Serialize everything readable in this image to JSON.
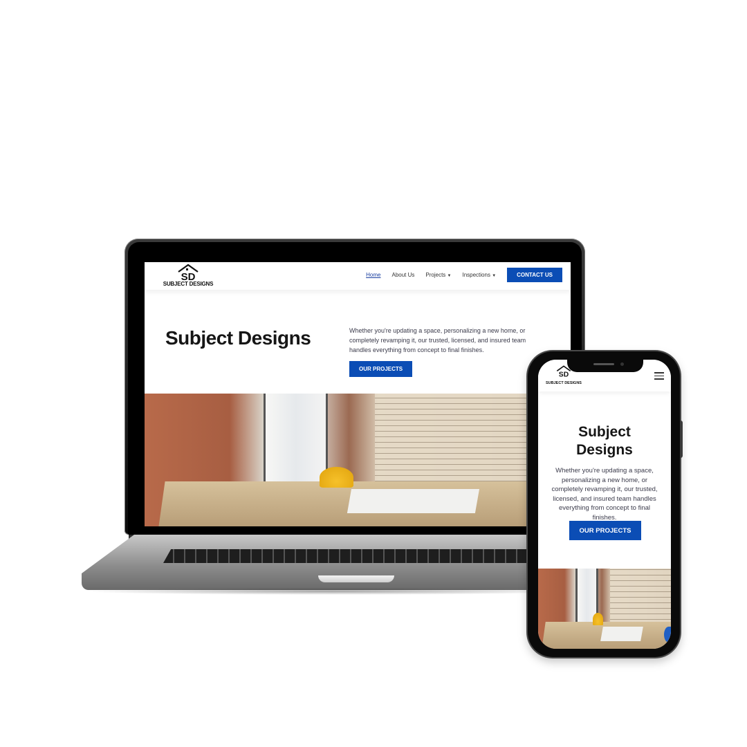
{
  "site": {
    "logo_text": "SUBJECT DESIGNS",
    "nav": {
      "items": [
        {
          "label": "Home",
          "active": true
        },
        {
          "label": "About Us"
        },
        {
          "label": "Projects",
          "dropdown": true
        },
        {
          "label": "Inspections",
          "dropdown": true
        }
      ],
      "contact_label": "CONTACT US"
    },
    "hero": {
      "title": "Subject Designs",
      "text": "Whether you're updating a space, personalizing a new home, or completely revamping it, our trusted, licensed, and insured team handles everything from concept to final finishes.",
      "button_label": "OUR PROJECTS"
    },
    "image_icon": "construction-site-photo",
    "colors": {
      "accent": "#0b4db5",
      "text": "#161616"
    }
  },
  "mobile": {
    "logo_text": "SUBJECT DESIGNS",
    "title_line1": "Subject",
    "title_line2": "Designs",
    "text": "Whether you're updating a space, personalizing a new home, or completely revamping it, our trusted, licensed, and insured team handles everything from concept to final finishes.",
    "button_label": "OUR PROJECTS",
    "menu_icon": "hamburger-icon"
  }
}
